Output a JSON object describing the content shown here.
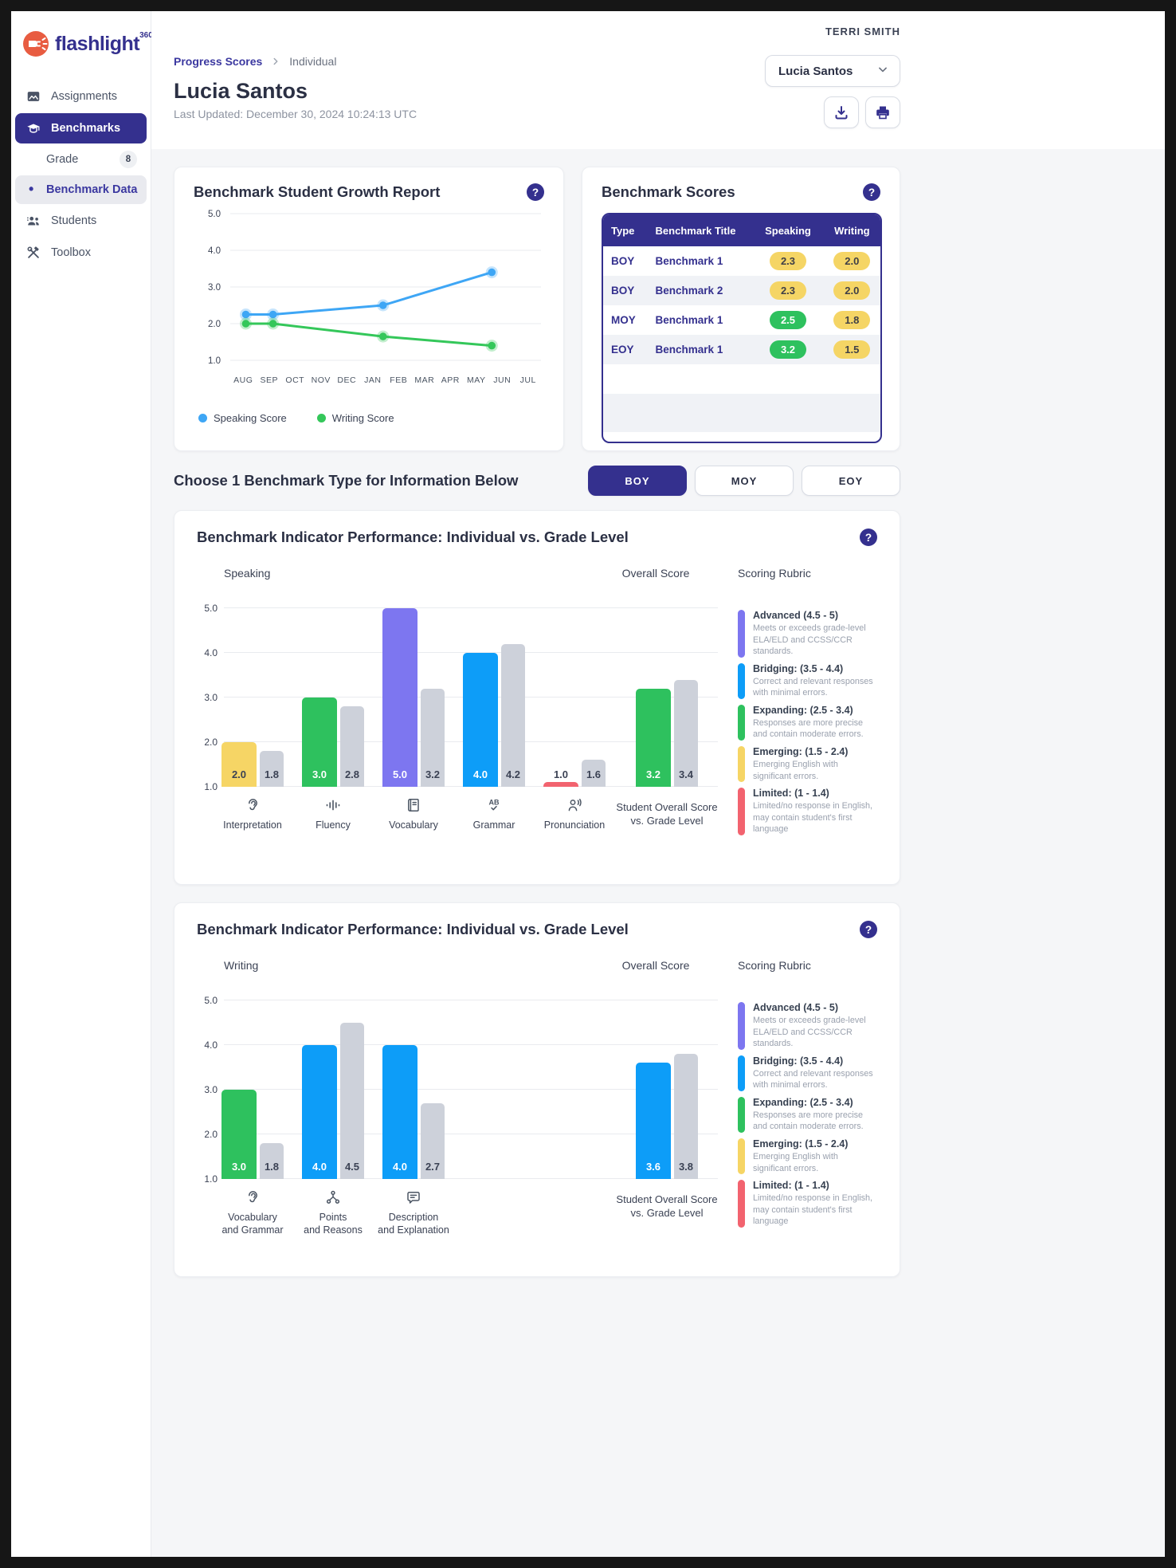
{
  "ui": {
    "help_glyph": "?",
    "bullet": "•"
  },
  "frame": {
    "user_label": "TERRI SMITH"
  },
  "sidebar": {
    "logo_text": "flashlight",
    "logo_sup": "360",
    "items": [
      {
        "label": "Assignments"
      },
      {
        "label": "Benchmarks",
        "active": true
      },
      {
        "label": "Grade",
        "badge": "8"
      },
      {
        "label": "Benchmark Data",
        "selected": true
      },
      {
        "label": "Students"
      },
      {
        "label": "Toolbox"
      }
    ]
  },
  "header": {
    "breadcrumb": {
      "parent": "Progress Scores",
      "current": "Individual"
    },
    "student_name": "Lucia Santos",
    "last_updated": "Last Updated: December 30, 2024 10:24:13 UTC",
    "student_select": "Lucia Santos"
  },
  "growth_card": {
    "title": "Benchmark Student Growth Report",
    "legend": [
      {
        "label": "Speaking Score",
        "color": "#3EA6F5"
      },
      {
        "label": "Writing Score",
        "color": "#34C75A"
      }
    ],
    "chart_data": {
      "type": "line",
      "x_labels": [
        "AUG",
        "SEP",
        "OCT",
        "NOV",
        "DEC",
        "JAN",
        "FEB",
        "MAR",
        "APR",
        "MAY",
        "JUN",
        "JUL"
      ],
      "yticks": [
        "5.0",
        "4.0",
        "3.0",
        "2.0",
        "1.0"
      ],
      "ylim": [
        1.0,
        5.0
      ],
      "series": [
        {
          "name": "Speaking Score",
          "color": "#3EA6F5",
          "points": [
            {
              "x": 0.1,
              "y": 2.25
            },
            {
              "x": 1.15,
              "y": 2.25
            },
            {
              "x": 5.4,
              "y": 2.5
            },
            {
              "x": 9.6,
              "y": 3.4
            }
          ]
        },
        {
          "name": "Writing Score",
          "color": "#34C75A",
          "points": [
            {
              "x": 0.1,
              "y": 2.0
            },
            {
              "x": 1.15,
              "y": 2.0
            },
            {
              "x": 5.4,
              "y": 1.65
            },
            {
              "x": 9.6,
              "y": 1.4
            }
          ]
        }
      ]
    }
  },
  "scores_card": {
    "title": "Benchmark Scores",
    "columns": [
      "Type",
      "Benchmark Title",
      "Speaking",
      "Writing"
    ],
    "rows": [
      {
        "type": "BOY",
        "title": "Benchmark 1",
        "speaking": {
          "value": "2.3",
          "level": "emerging"
        },
        "writing": {
          "value": "2.0",
          "level": "emerging"
        }
      },
      {
        "type": "BOY",
        "title": "Benchmark 2",
        "speaking": {
          "value": "2.3",
          "level": "emerging"
        },
        "writing": {
          "value": "2.0",
          "level": "emerging"
        }
      },
      {
        "type": "MOY",
        "title": "Benchmark 1",
        "speaking": {
          "value": "2.5",
          "level": "expanding"
        },
        "writing": {
          "value": "1.8",
          "level": "emerging"
        }
      },
      {
        "type": "EOY",
        "title": "Benchmark 1",
        "speaking": {
          "value": "3.2",
          "level": "expanding"
        },
        "writing": {
          "value": "1.5",
          "level": "emerging"
        }
      }
    ]
  },
  "benchmark_type": {
    "heading": "Choose 1 Benchmark Type for Information Below",
    "options": [
      {
        "label": "BOY",
        "active": true
      },
      {
        "label": "MOY",
        "active": false
      },
      {
        "label": "EOY",
        "active": false
      }
    ]
  },
  "rubric": {
    "heading": "Scoring Rubric",
    "items": [
      {
        "title": "Advanced (4.5 - 5)",
        "desc": "Meets or exceeds grade-level ELA/ELD and CCSS/CCR standards.",
        "color": "#7D76F0"
      },
      {
        "title": "Bridging: (3.5 - 4.4)",
        "desc": "Correct and relevant responses with minimal errors.",
        "color": "#0D9DF8"
      },
      {
        "title": "Expanding: (2.5 - 3.4)",
        "desc": "Responses are more precise and contain moderate errors.",
        "color": "#2EC15E"
      },
      {
        "title": "Emerging: (1.5 - 2.4)",
        "desc": "Emerging English with significant errors.",
        "color": "#F6D565"
      },
      {
        "title": "Limited: (1 - 1.4)",
        "desc": "Limited/no response in English, may contain student's first language",
        "color": "#F2636F"
      }
    ]
  },
  "speaking_card": {
    "title": "Benchmark Indicator Performance: Individual vs. Grade Level",
    "subtitle": "Speaking",
    "overall_label": "Overall Score",
    "rubric_heading": "Scoring Rubric",
    "chart_data": {
      "type": "bar",
      "ylim": [
        1,
        5
      ],
      "yticks": [
        "5.0",
        "4.0",
        "3.0",
        "2.0",
        "1.0"
      ],
      "grade_bar_color": "#CDD1DA",
      "groups": [
        {
          "label_lines": [
            "Interpretation"
          ],
          "icon": "ear-icon",
          "role": "indicator",
          "student": 2.0,
          "grade": 1.8,
          "color": "#F6D565",
          "text": "dark"
        },
        {
          "label_lines": [
            "Fluency"
          ],
          "icon": "fluency-icon",
          "role": "indicator",
          "student": 3.0,
          "grade": 2.8,
          "color": "#2EC15E",
          "text": "light"
        },
        {
          "label_lines": [
            "Vocabulary"
          ],
          "icon": "book-icon",
          "role": "indicator",
          "student": 5.0,
          "grade": 3.2,
          "color": "#7D76F0",
          "text": "light"
        },
        {
          "label_lines": [
            "Grammar"
          ],
          "icon": "grammar-icon",
          "role": "indicator",
          "student": 4.0,
          "grade": 4.2,
          "color": "#0D9DF8",
          "text": "light"
        },
        {
          "label_lines": [
            "Pronunciation"
          ],
          "icon": "pronunciation-icon",
          "role": "indicator",
          "student": 1.0,
          "grade": 1.6,
          "color": "#F2636F",
          "text": "dark"
        },
        {
          "label_lines": [
            "Student Overall Score",
            "vs. Grade Level"
          ],
          "icon": null,
          "role": "overall",
          "student": 3.2,
          "grade": 3.4,
          "color": "#2EC15E",
          "text": "light"
        }
      ]
    }
  },
  "writing_card": {
    "title": "Benchmark Indicator Performance: Individual vs. Grade Level",
    "subtitle": "Writing",
    "overall_label": "Overall Score",
    "rubric_heading": "Scoring Rubric",
    "chart_data": {
      "type": "bar",
      "ylim": [
        1,
        5
      ],
      "yticks": [
        "5.0",
        "4.0",
        "3.0",
        "2.0",
        "1.0"
      ],
      "grade_bar_color": "#CDD1DA",
      "groups": [
        {
          "label_lines": [
            "Vocabulary",
            "and Grammar"
          ],
          "icon": "ear-icon",
          "role": "indicator",
          "student": 3.0,
          "grade": 1.8,
          "color": "#2EC15E",
          "text": "light"
        },
        {
          "label_lines": [
            "Points",
            "and Reasons"
          ],
          "icon": "network-icon",
          "role": "indicator",
          "student": 4.0,
          "grade": 4.5,
          "color": "#0D9DF8",
          "text": "light"
        },
        {
          "label_lines": [
            "Description",
            "and Explanation"
          ],
          "icon": "chat-icon",
          "role": "indicator",
          "student": 4.0,
          "grade": 2.7,
          "color": "#0D9DF8",
          "text": "light"
        },
        {
          "label_lines": [
            "Student Overall Score",
            "vs. Grade Level"
          ],
          "icon": null,
          "role": "overall",
          "student": 3.6,
          "grade": 3.8,
          "color": "#0D9DF8",
          "text": "light"
        }
      ]
    }
  }
}
